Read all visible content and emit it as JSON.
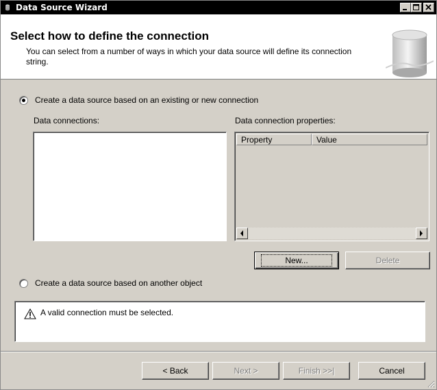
{
  "window": {
    "title": "Data Source Wizard",
    "icon": "wizard-app-icon"
  },
  "titlebar_buttons": {
    "minimize": "minimize-icon",
    "maximize": "maximize-icon",
    "close": "close-icon"
  },
  "header": {
    "title": "Select how to define the connection",
    "description": "You can select from a number of ways in which your data source will define its connection string.",
    "graphic": "database-cylinder-icon"
  },
  "options": {
    "existing_connection": {
      "label": "Create a data source based on an existing or new connection",
      "selected": true
    },
    "another_object": {
      "label": "Create a data source based on another object",
      "selected": false
    }
  },
  "data_connections": {
    "label": "Data connections:",
    "items": []
  },
  "connection_properties": {
    "label": "Data connection properties:",
    "columns": [
      "Property",
      "Value"
    ],
    "rows": []
  },
  "buttons": {
    "new": "New...",
    "delete": "Delete",
    "back": "< Back",
    "next": "Next >",
    "finish": "Finish >>|",
    "cancel": "Cancel"
  },
  "message": {
    "icon": "warning-icon",
    "text": "A valid connection must be selected."
  },
  "colors": {
    "window_bg": "#d4d0c8",
    "titlebar": "#000000",
    "disabled_text": "#808080"
  }
}
